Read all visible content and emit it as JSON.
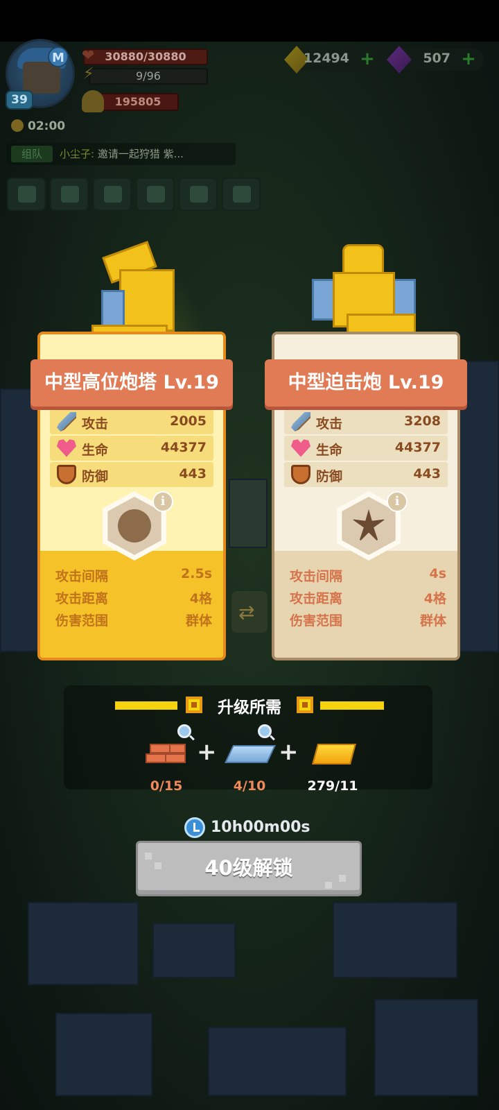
{
  "hud": {
    "level": "39",
    "avatar_badge": "M",
    "hp": "30880/30880",
    "energy": "9/96",
    "power": "195805",
    "timer": "02:00",
    "chat_tag": "组队",
    "chat_sender": "小尘子:",
    "chat_message": "邀请一起狩猎 紫..."
  },
  "currency": {
    "gold": "12494",
    "gems": "507"
  },
  "cards": [
    {
      "title": "中型高位炮塔 Lv.19",
      "stats": [
        {
          "label": "攻击",
          "value": "2005",
          "icon": "sword-icon"
        },
        {
          "label": "生命",
          "value": "44377",
          "icon": "heart-icon"
        },
        {
          "label": "防御",
          "value": "443",
          "icon": "shield-icon"
        }
      ],
      "skill_icon": "spike-blast-icon",
      "attrs": [
        {
          "label": "攻击间隔",
          "value": "2.5s"
        },
        {
          "label": "攻击距离",
          "value": "4格"
        },
        {
          "label": "伤害范围",
          "value": "群体"
        }
      ]
    },
    {
      "title": "中型迫击炮 Lv.19",
      "stats": [
        {
          "label": "攻击",
          "value": "3208",
          "icon": "sword-icon"
        },
        {
          "label": "生命",
          "value": "44377",
          "icon": "heart-icon"
        },
        {
          "label": "防御",
          "value": "443",
          "icon": "shield-icon"
        }
      ],
      "skill_icon": "explosion-icon",
      "attrs": [
        {
          "label": "攻击间隔",
          "value": "4s"
        },
        {
          "label": "攻击距离",
          "value": "4格"
        },
        {
          "label": "伤害范围",
          "value": "群体"
        }
      ]
    }
  ],
  "upgrade": {
    "title": "升级所需",
    "materials": [
      {
        "name": "brick-material",
        "count": "0/15"
      },
      {
        "name": "steel-plate-material",
        "count": "4/10"
      },
      {
        "name": "gold-bar-material",
        "count": "279/11"
      }
    ],
    "duration": "10h00m00s",
    "button_label": "40级解锁"
  },
  "colors": {
    "left_card_accent": "#f6cf2e",
    "banner": "#e17b55",
    "material_shortfall": "#f08a5c",
    "button_disabled": "#bdbdbd"
  }
}
